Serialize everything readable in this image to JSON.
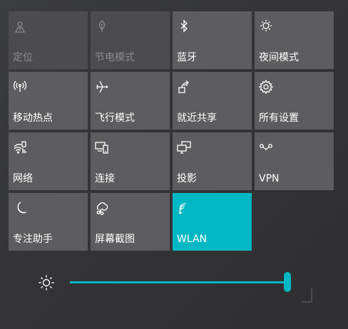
{
  "tiles": [
    {
      "label": "定位",
      "icon": "location-icon",
      "state": "disabled"
    },
    {
      "label": "节电模式",
      "icon": "battery-saver-icon",
      "state": "disabled"
    },
    {
      "label": "蓝牙",
      "icon": "bluetooth-icon",
      "state": "off"
    },
    {
      "label": "夜间模式",
      "icon": "night-light-icon",
      "state": "off"
    },
    {
      "label": "移动热点",
      "icon": "mobile-hotspot-icon",
      "state": "off"
    },
    {
      "label": "飞行模式",
      "icon": "airplane-icon",
      "state": "off"
    },
    {
      "label": "就近共享",
      "icon": "nearby-share-icon",
      "state": "off"
    },
    {
      "label": "所有设置",
      "icon": "settings-gear-icon",
      "state": "off"
    },
    {
      "label": "网络",
      "icon": "network-icon",
      "state": "off"
    },
    {
      "label": "连接",
      "icon": "connect-icon",
      "state": "off"
    },
    {
      "label": "投影",
      "icon": "project-icon",
      "state": "off"
    },
    {
      "label": "VPN",
      "icon": "vpn-icon",
      "state": "off"
    },
    {
      "label": "专注助手",
      "icon": "focus-assist-moon-icon",
      "state": "off"
    },
    {
      "label": "屏幕截图",
      "icon": "screen-snip-icon",
      "state": "off"
    },
    {
      "label": "WLAN",
      "icon": "wifi-icon",
      "state": "on"
    }
  ],
  "brightness": {
    "icon": "brightness-sun-icon",
    "level_percent": 100
  },
  "colors": {
    "accent": "#00b7c3",
    "tile": "#5d5d5f",
    "tile_disabled": "#4c4c4e",
    "disabled_text": "#8b8b8d",
    "background": "#353538"
  }
}
